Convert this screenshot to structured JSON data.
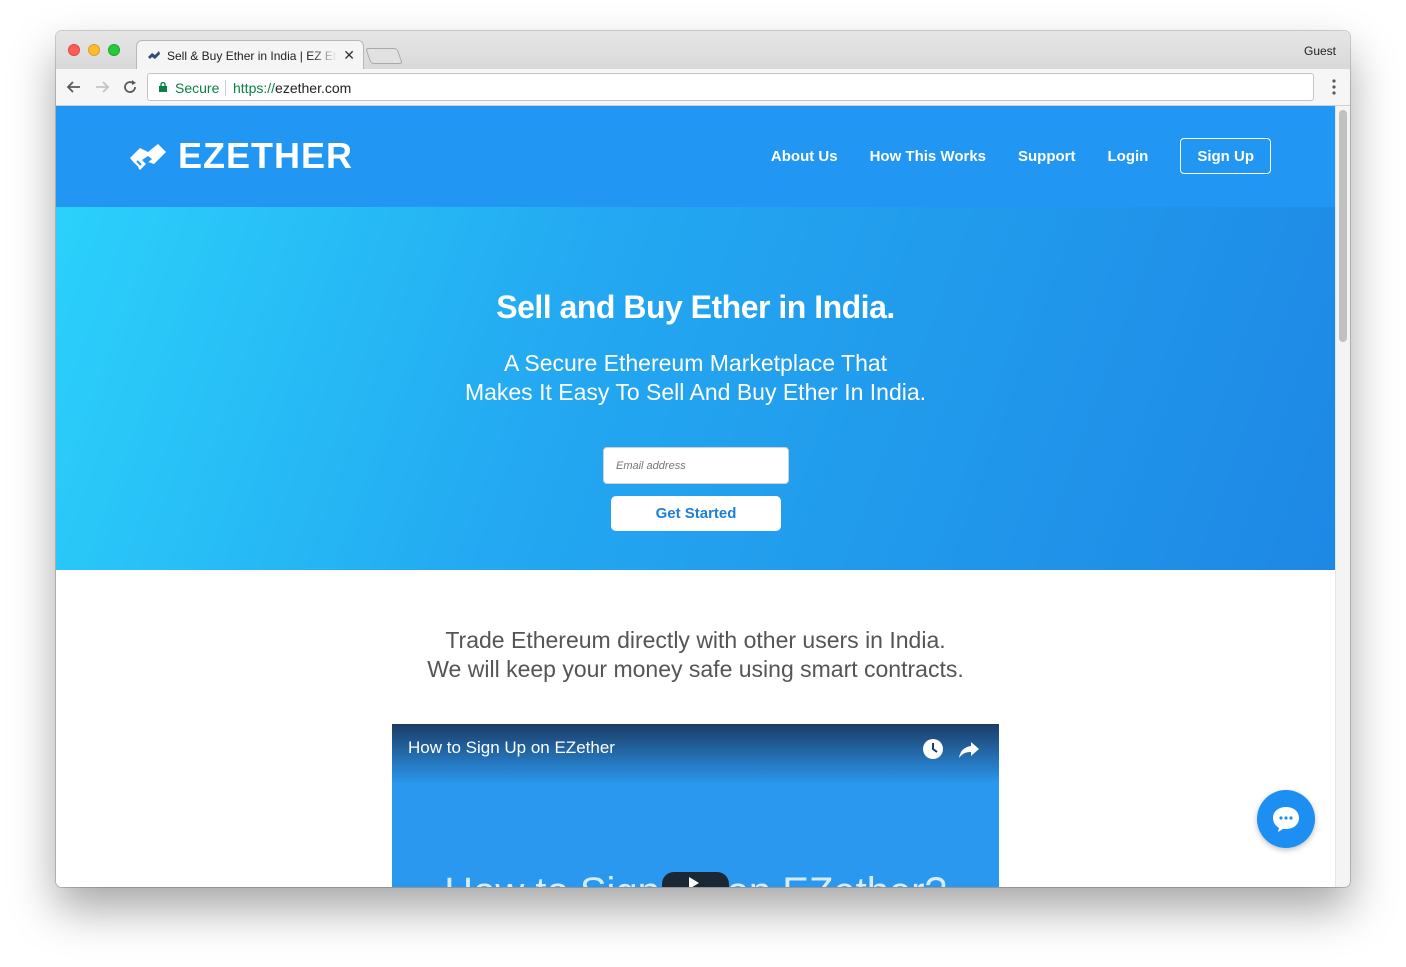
{
  "browser": {
    "tab_title": "Sell & Buy Ether in India | EZ Ether",
    "tab_close": "✕",
    "profile": "Guest",
    "security_label": "Secure",
    "url_scheme": "https://",
    "url_host": "ezether.com"
  },
  "header": {
    "logo_text": "EZETHER",
    "nav": {
      "about": "About Us",
      "how": "How This Works",
      "support": "Support",
      "login": "Login",
      "signup": "Sign Up"
    }
  },
  "hero": {
    "title": "Sell and Buy Ether in India.",
    "subtitle_line1": "A Secure Ethereum Marketplace That",
    "subtitle_line2": "Makes It Easy To Sell And Buy Ether In India.",
    "email_placeholder": "Email address",
    "cta": "Get Started"
  },
  "intro": {
    "line1": "Trade Ethereum directly with other users in India.",
    "line2": "We will keep your money safe using smart contracts."
  },
  "video": {
    "title": "How to Sign Up on EZether",
    "big_text": "How to Sign up on EZether?"
  },
  "colors": {
    "brand_blue": "#2196f3",
    "hero_gradient_start": "#2bd1fb",
    "hero_gradient_end": "#1e88e5",
    "secure_green": "#0b8043"
  },
  "icons": [
    "back-arrow-icon",
    "forward-arrow-icon",
    "reload-icon",
    "lock-icon",
    "menu-dots-icon",
    "logo-handshake-icon",
    "watch-later-icon",
    "share-icon",
    "play-icon",
    "chat-icon"
  ]
}
